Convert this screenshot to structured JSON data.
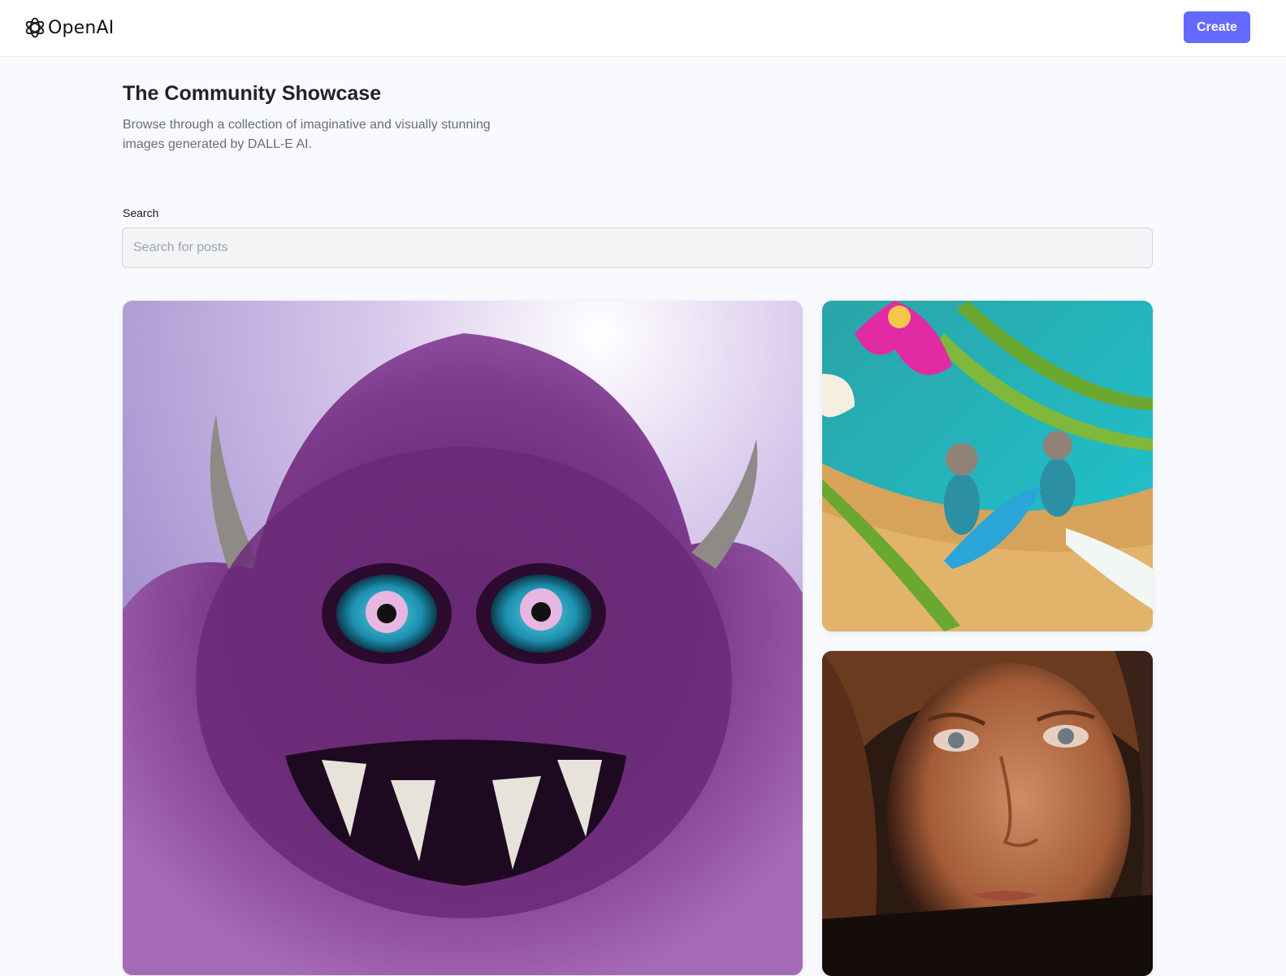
{
  "header": {
    "logo_text": "OpenAI",
    "logo_icon": "openai-logo-icon",
    "create_label": "Create",
    "accent_color": "#6469ff"
  },
  "hero": {
    "title": "The Community Showcase",
    "subtitle": "Browse through a collection of imaginative and visually stunning images generated by DALL-E AI."
  },
  "search": {
    "label": "Search",
    "placeholder": "Search for posts",
    "value": ""
  },
  "gallery": {
    "posts": [
      {
        "image": "purple-furry-monster"
      },
      {
        "image": "mice-surfers-beach"
      },
      {
        "image": "woman-portrait"
      }
    ]
  }
}
